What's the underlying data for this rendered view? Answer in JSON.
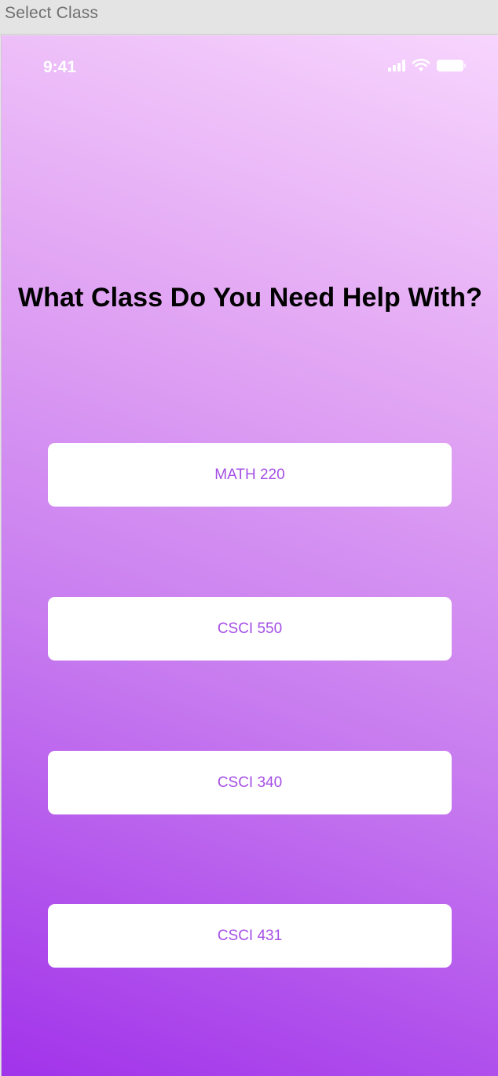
{
  "window": {
    "title": "Select Class"
  },
  "status_bar": {
    "time": "9:41",
    "icons": [
      "cellular-signal-icon",
      "wifi-icon",
      "battery-icon"
    ]
  },
  "heading": "What Class Do You Need Help With?",
  "classes": [
    {
      "label": "MATH 220"
    },
    {
      "label": "CSCI 550"
    },
    {
      "label": "CSCI 340"
    },
    {
      "label": "CSCI 431"
    }
  ],
  "colors": {
    "gradient_top": "#f7d5fd",
    "gradient_bottom": "#a133ea",
    "button_background": "#ffffff",
    "button_text": "#a54fe6",
    "heading_text": "#000000"
  }
}
